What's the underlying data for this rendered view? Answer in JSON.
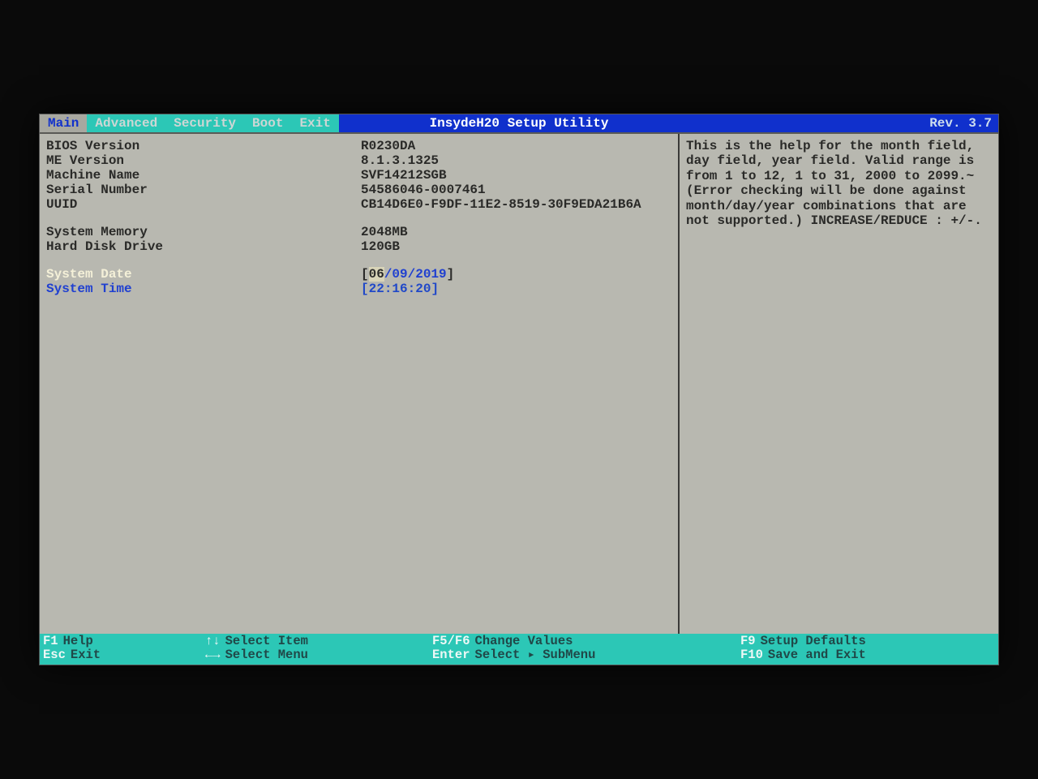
{
  "header": {
    "title": "InsydeH20 Setup Utility",
    "revision": "Rev. 3.7"
  },
  "menu": {
    "items": [
      "Main",
      "Advanced",
      "Security",
      "Boot",
      "Exit"
    ],
    "active": "Main"
  },
  "info": {
    "bios_version_label": "BIOS Version",
    "bios_version": "R0230DA",
    "me_version_label": "ME Version",
    "me_version": "8.1.3.1325",
    "machine_name_label": "Machine Name",
    "machine_name": "SVF14212SGB",
    "serial_label": "Serial Number",
    "serial": "54586046-0007461",
    "uuid_label": "UUID",
    "uuid": "CB14D6E0-F9DF-11E2-8519-30F9EDA21B6A",
    "memory_label": "System Memory",
    "memory": "2048MB",
    "hdd_label": "Hard Disk Drive",
    "hdd": "120GB"
  },
  "datetime": {
    "date_label": "System Date",
    "date_mm": "06",
    "date_dd": "09",
    "date_yyyy": "2019",
    "time_label": "System Time",
    "time_hh": "22",
    "time_mm": "16",
    "time_ss": "20"
  },
  "help": {
    "text": "This is the help for the month field, day field, year field. Valid range is from 1 to 12, 1 to 31, 2000 to 2099.~(Error checking will be done against month/day/year combinations that are not supported.) INCREASE/REDUCE : +/-."
  },
  "footer": {
    "f1_key": "F1",
    "f1": "Help",
    "esc_key": "Esc",
    "esc": "Exit",
    "updown_key": "↑↓",
    "updown": "Select Item",
    "leftright_key": "←→",
    "leftright": "Select Menu",
    "f5f6_key": "F5/F6",
    "f5f6": "Change Values",
    "enter_key": "Enter",
    "enter": "Select ▸ SubMenu",
    "f9_key": "F9",
    "f9": "Setup Defaults",
    "f10_key": "F10",
    "f10": "Save and Exit"
  }
}
